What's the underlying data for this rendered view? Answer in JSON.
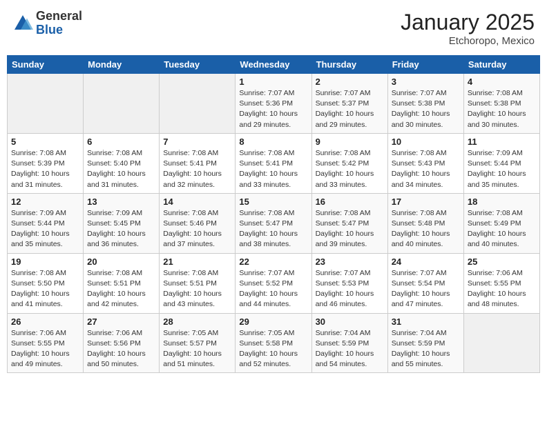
{
  "header": {
    "logo_general": "General",
    "logo_blue": "Blue",
    "month_title": "January 2025",
    "location": "Etchoropo, Mexico"
  },
  "weekdays": [
    "Sunday",
    "Monday",
    "Tuesday",
    "Wednesday",
    "Thursday",
    "Friday",
    "Saturday"
  ],
  "weeks": [
    [
      {
        "day": "",
        "sunrise": "",
        "sunset": "",
        "daylight": ""
      },
      {
        "day": "",
        "sunrise": "",
        "sunset": "",
        "daylight": ""
      },
      {
        "day": "",
        "sunrise": "",
        "sunset": "",
        "daylight": ""
      },
      {
        "day": "1",
        "sunrise": "Sunrise: 7:07 AM",
        "sunset": "Sunset: 5:36 PM",
        "daylight": "Daylight: 10 hours and 29 minutes."
      },
      {
        "day": "2",
        "sunrise": "Sunrise: 7:07 AM",
        "sunset": "Sunset: 5:37 PM",
        "daylight": "Daylight: 10 hours and 29 minutes."
      },
      {
        "day": "3",
        "sunrise": "Sunrise: 7:07 AM",
        "sunset": "Sunset: 5:38 PM",
        "daylight": "Daylight: 10 hours and 30 minutes."
      },
      {
        "day": "4",
        "sunrise": "Sunrise: 7:08 AM",
        "sunset": "Sunset: 5:38 PM",
        "daylight": "Daylight: 10 hours and 30 minutes."
      }
    ],
    [
      {
        "day": "5",
        "sunrise": "Sunrise: 7:08 AM",
        "sunset": "Sunset: 5:39 PM",
        "daylight": "Daylight: 10 hours and 31 minutes."
      },
      {
        "day": "6",
        "sunrise": "Sunrise: 7:08 AM",
        "sunset": "Sunset: 5:40 PM",
        "daylight": "Daylight: 10 hours and 31 minutes."
      },
      {
        "day": "7",
        "sunrise": "Sunrise: 7:08 AM",
        "sunset": "Sunset: 5:41 PM",
        "daylight": "Daylight: 10 hours and 32 minutes."
      },
      {
        "day": "8",
        "sunrise": "Sunrise: 7:08 AM",
        "sunset": "Sunset: 5:41 PM",
        "daylight": "Daylight: 10 hours and 33 minutes."
      },
      {
        "day": "9",
        "sunrise": "Sunrise: 7:08 AM",
        "sunset": "Sunset: 5:42 PM",
        "daylight": "Daylight: 10 hours and 33 minutes."
      },
      {
        "day": "10",
        "sunrise": "Sunrise: 7:08 AM",
        "sunset": "Sunset: 5:43 PM",
        "daylight": "Daylight: 10 hours and 34 minutes."
      },
      {
        "day": "11",
        "sunrise": "Sunrise: 7:09 AM",
        "sunset": "Sunset: 5:44 PM",
        "daylight": "Daylight: 10 hours and 35 minutes."
      }
    ],
    [
      {
        "day": "12",
        "sunrise": "Sunrise: 7:09 AM",
        "sunset": "Sunset: 5:44 PM",
        "daylight": "Daylight: 10 hours and 35 minutes."
      },
      {
        "day": "13",
        "sunrise": "Sunrise: 7:09 AM",
        "sunset": "Sunset: 5:45 PM",
        "daylight": "Daylight: 10 hours and 36 minutes."
      },
      {
        "day": "14",
        "sunrise": "Sunrise: 7:08 AM",
        "sunset": "Sunset: 5:46 PM",
        "daylight": "Daylight: 10 hours and 37 minutes."
      },
      {
        "day": "15",
        "sunrise": "Sunrise: 7:08 AM",
        "sunset": "Sunset: 5:47 PM",
        "daylight": "Daylight: 10 hours and 38 minutes."
      },
      {
        "day": "16",
        "sunrise": "Sunrise: 7:08 AM",
        "sunset": "Sunset: 5:47 PM",
        "daylight": "Daylight: 10 hours and 39 minutes."
      },
      {
        "day": "17",
        "sunrise": "Sunrise: 7:08 AM",
        "sunset": "Sunset: 5:48 PM",
        "daylight": "Daylight: 10 hours and 40 minutes."
      },
      {
        "day": "18",
        "sunrise": "Sunrise: 7:08 AM",
        "sunset": "Sunset: 5:49 PM",
        "daylight": "Daylight: 10 hours and 40 minutes."
      }
    ],
    [
      {
        "day": "19",
        "sunrise": "Sunrise: 7:08 AM",
        "sunset": "Sunset: 5:50 PM",
        "daylight": "Daylight: 10 hours and 41 minutes."
      },
      {
        "day": "20",
        "sunrise": "Sunrise: 7:08 AM",
        "sunset": "Sunset: 5:51 PM",
        "daylight": "Daylight: 10 hours and 42 minutes."
      },
      {
        "day": "21",
        "sunrise": "Sunrise: 7:08 AM",
        "sunset": "Sunset: 5:51 PM",
        "daylight": "Daylight: 10 hours and 43 minutes."
      },
      {
        "day": "22",
        "sunrise": "Sunrise: 7:07 AM",
        "sunset": "Sunset: 5:52 PM",
        "daylight": "Daylight: 10 hours and 44 minutes."
      },
      {
        "day": "23",
        "sunrise": "Sunrise: 7:07 AM",
        "sunset": "Sunset: 5:53 PM",
        "daylight": "Daylight: 10 hours and 46 minutes."
      },
      {
        "day": "24",
        "sunrise": "Sunrise: 7:07 AM",
        "sunset": "Sunset: 5:54 PM",
        "daylight": "Daylight: 10 hours and 47 minutes."
      },
      {
        "day": "25",
        "sunrise": "Sunrise: 7:06 AM",
        "sunset": "Sunset: 5:55 PM",
        "daylight": "Daylight: 10 hours and 48 minutes."
      }
    ],
    [
      {
        "day": "26",
        "sunrise": "Sunrise: 7:06 AM",
        "sunset": "Sunset: 5:55 PM",
        "daylight": "Daylight: 10 hours and 49 minutes."
      },
      {
        "day": "27",
        "sunrise": "Sunrise: 7:06 AM",
        "sunset": "Sunset: 5:56 PM",
        "daylight": "Daylight: 10 hours and 50 minutes."
      },
      {
        "day": "28",
        "sunrise": "Sunrise: 7:05 AM",
        "sunset": "Sunset: 5:57 PM",
        "daylight": "Daylight: 10 hours and 51 minutes."
      },
      {
        "day": "29",
        "sunrise": "Sunrise: 7:05 AM",
        "sunset": "Sunset: 5:58 PM",
        "daylight": "Daylight: 10 hours and 52 minutes."
      },
      {
        "day": "30",
        "sunrise": "Sunrise: 7:04 AM",
        "sunset": "Sunset: 5:59 PM",
        "daylight": "Daylight: 10 hours and 54 minutes."
      },
      {
        "day": "31",
        "sunrise": "Sunrise: 7:04 AM",
        "sunset": "Sunset: 5:59 PM",
        "daylight": "Daylight: 10 hours and 55 minutes."
      },
      {
        "day": "",
        "sunrise": "",
        "sunset": "",
        "daylight": ""
      }
    ]
  ]
}
